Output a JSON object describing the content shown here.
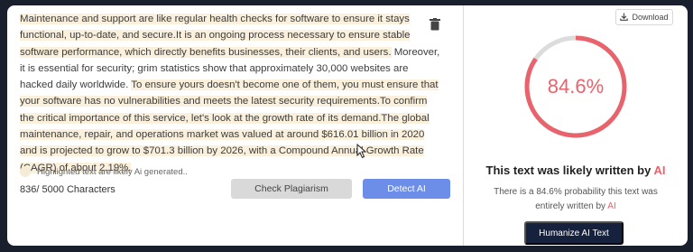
{
  "editor": {
    "segments": [
      {
        "text": " Maintenance and support are like regular health checks for software to ensure it stays functional, up-to-date, and secure.",
        "highlight": true
      },
      {
        "text": "It is an ongoing process necessary to ensure stable software performance, which directly benefits businesses, their clients, and users.",
        "highlight": true
      },
      {
        "text": " Moreover, it is essential for security; grim statistics show that approximately 30,000 websites are hacked daily worldwide. ",
        "highlight": false
      },
      {
        "text": "To ensure yours doesn't become one of them, you must ensure that your software has no vulnerabilities and meets the latest security requirements.",
        "highlight": true
      },
      {
        "text": "To confirm the critical importance of this service, let's look at the growth rate of its demand.",
        "highlight": true
      },
      {
        "text": "The global maintenance, repair, and operations market was valued at around $616.01 billion in 2020 and is projected to grow to $701.3 billion by 2026, with a Compound Annual Growth Rate (CAGR) of about 2.19%.",
        "highlight": true
      }
    ]
  },
  "legend": {
    "label": "Highlighted text are likely Ai generated.."
  },
  "char_count": "836/ 5000 Characters",
  "buttons": {
    "check_plagiarism": "Check Plagiarism",
    "detect_ai": "Detect AI",
    "download": "Download",
    "humanize": "Humanize AI Text"
  },
  "result": {
    "score_text": "84.6%",
    "score_fraction": 0.846,
    "verdict_prefix": "This text was likely written by ",
    "verdict_accent": "AI",
    "prob_line1": "There is a 84.6% probability this text was",
    "prob_line2_prefix": "entirely written by ",
    "prob_line2_accent": "AI"
  },
  "colors": {
    "gauge": "#e8636c",
    "gauge_track": "#dcdcdc",
    "highlight": "#fbf0dc",
    "detect_button": "#6c8de8",
    "humanize_button": "#15213d"
  },
  "icons": [
    "trash-icon",
    "download-icon",
    "cursor-icon"
  ]
}
